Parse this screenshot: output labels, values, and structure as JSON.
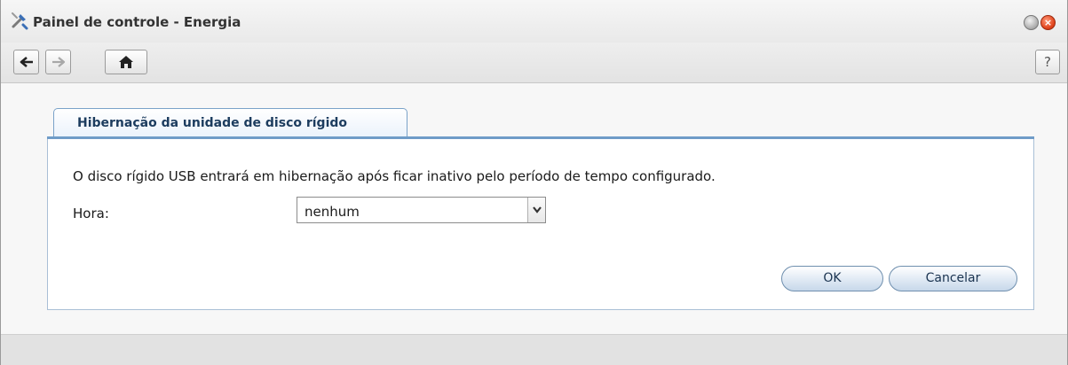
{
  "window": {
    "title": "Painel de controle - Energia",
    "icon": "tools-icon",
    "controls": [
      "minimize-icon",
      "close-icon"
    ]
  },
  "toolbar": {
    "back_icon": "arrow-left-icon",
    "forward_icon": "arrow-right-icon",
    "home_icon": "home-icon",
    "help_label": "?"
  },
  "tab": {
    "label": "Hibernação da unidade de disco rígido"
  },
  "form": {
    "description": "O disco rígido USB entrará em hibernação após ficar inativo pelo período de tempo configurado.",
    "time_label": "Hora:",
    "time_value": "nenhum"
  },
  "buttons": {
    "ok_label": "OK",
    "cancel_label": "Cancelar"
  },
  "colors": {
    "tab_border": "#7aa2c9",
    "tab_text": "#1c3c5e",
    "close_button": "#e0431c"
  }
}
